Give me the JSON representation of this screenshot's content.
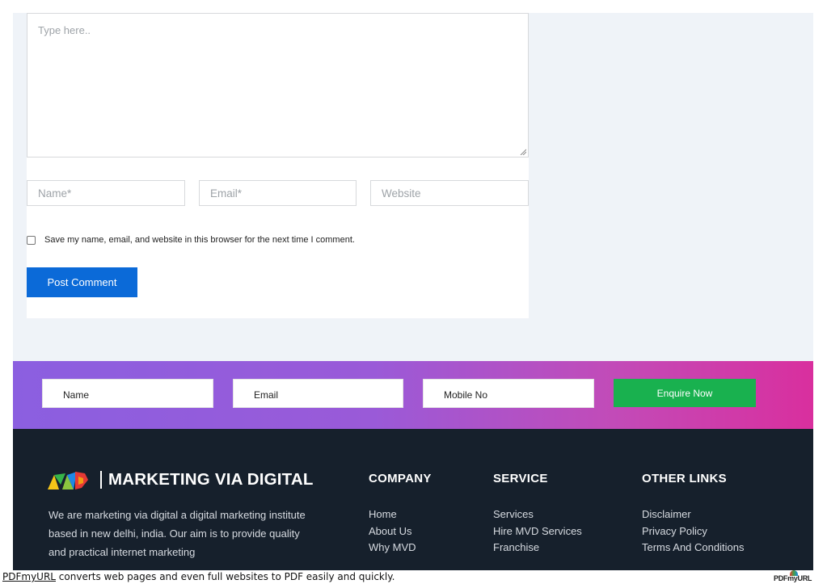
{
  "comment_form": {
    "comment_placeholder": "Type here..",
    "name_placeholder": "Name*",
    "email_placeholder": "Email*",
    "website_placeholder": "Website",
    "save_info_label": "Save my name, email, and website in this browser for the next time I comment.",
    "save_info_checked": false,
    "submit_label": "Post Comment"
  },
  "enquiry": {
    "name_placeholder": "Name",
    "email_placeholder": "Email",
    "mobile_placeholder": "Mobile No",
    "submit_label": "Enquire Now"
  },
  "footer": {
    "brand_name": "MARKETING VIA DIGITAL",
    "about": "We are marketing via digital a digital marketing institute based in new delhi, india. Our aim is to provide quality and practical internet marketing",
    "columns": [
      {
        "title": "COMPANY",
        "links": [
          "Home",
          "About Us",
          "Why MVD"
        ]
      },
      {
        "title": "SERVICE",
        "links": [
          "Services",
          "Hire MVD Services",
          "Franchise"
        ]
      },
      {
        "title": "OTHER LINKS",
        "links": [
          "Disclaimer",
          "Privacy Policy",
          "Terms And Conditions"
        ]
      }
    ]
  },
  "pdf_banner": {
    "link_text": "PDFmyURL",
    "text": " converts web pages and even full websites to PDF easily and quickly.",
    "logo_text": "PDFmyURL"
  },
  "colors": {
    "primary_button": "#0b6ad8",
    "enquire_button": "#19b14f",
    "footer_bg": "#16202c",
    "band_gradient_start": "#8b5fe0",
    "band_gradient_end": "#d92f9e"
  }
}
